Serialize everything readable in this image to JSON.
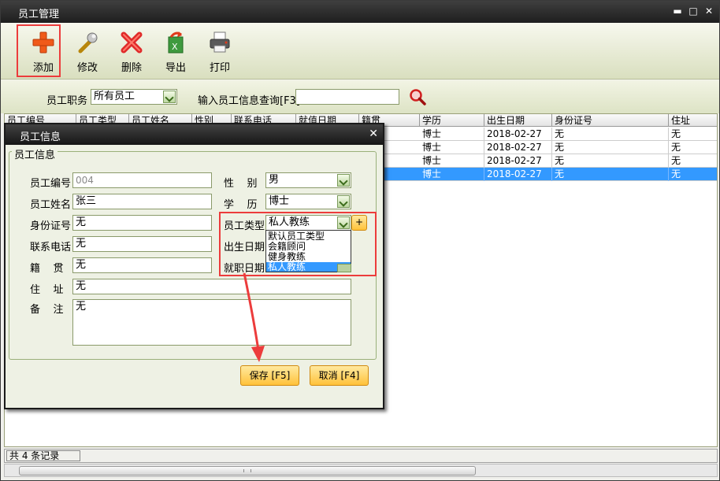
{
  "window": {
    "title": "员工管理",
    "min": "▬",
    "max": "□",
    "close": "✕"
  },
  "toolbar": {
    "add": "添加",
    "edit": "修改",
    "delete": "删除",
    "export": "导出",
    "print": "打印"
  },
  "filter": {
    "position_label": "员工职务",
    "position_value": "所有员工",
    "search_label": "输入员工信息查询[F3]",
    "search_value": ""
  },
  "grid": {
    "columns": [
      "员工编号",
      "员工类型",
      "员工姓名",
      "性别",
      "联系电话",
      "就值日期",
      "籍贯",
      "学历",
      "出生日期",
      "身份证号",
      "住址"
    ],
    "rows": [
      {
        "edu": "博士",
        "birth": "2018-02-27",
        "id": "无",
        "addr": "无"
      },
      {
        "edu": "博士",
        "birth": "2018-02-27",
        "id": "无",
        "addr": "无"
      },
      {
        "edu": "博士",
        "birth": "2018-02-27",
        "id": "无",
        "addr": "无"
      },
      {
        "edu": "博士",
        "birth": "2018-02-27",
        "id": "无",
        "addr": "无"
      }
    ]
  },
  "status": {
    "record_count": "共 4 条记录"
  },
  "dialog": {
    "title": "员工信息",
    "group_title": "员工信息",
    "labels": {
      "emp_no": "员工编号",
      "name": "员工姓名",
      "id_no": "身份证号",
      "phone": "联系电话",
      "native": "籍    贯",
      "address": "住    址",
      "remark": "备    注",
      "gender": "性    别",
      "edu": "学    历",
      "type": "员工类型",
      "birth": "出生日期",
      "hire": "就职日期"
    },
    "values": {
      "emp_no": "004",
      "name": "张三",
      "id_no": "无",
      "phone": "无",
      "native": "无",
      "address": "无",
      "remark": "无",
      "gender": "男",
      "edu": "博士",
      "type": "私人教练"
    },
    "type_options": [
      "默认员工类型",
      "会籍顾问",
      "健身教练",
      "私人教练"
    ],
    "plus": "+",
    "save": "保存 [F5]",
    "cancel": "取消 [F4]"
  },
  "colors": {
    "selection": "#3399ff",
    "highlight": "#ec3c3c",
    "button": "#ffc23a"
  }
}
